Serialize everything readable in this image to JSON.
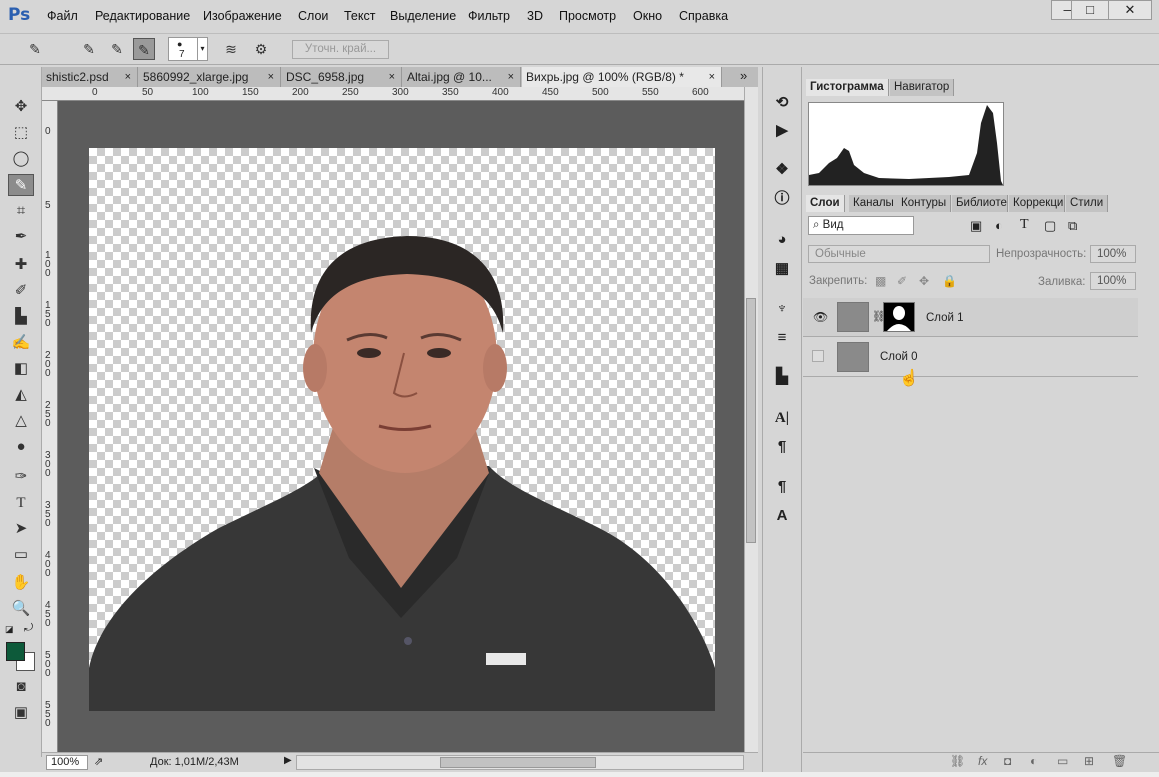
{
  "app": {
    "logo": "Ps"
  },
  "menu": [
    "Файл",
    "Редактирование",
    "Изображение",
    "Слои",
    "Текст",
    "Выделение",
    "Фильтр",
    "3D",
    "Просмотр",
    "Окно",
    "Справка"
  ],
  "window_controls": {
    "minimize": "—",
    "maximize": "□",
    "close": "✕"
  },
  "options": {
    "brush_size": "7",
    "refine_edge": "Уточн. край..."
  },
  "tabs": [
    {
      "label": "shistic2.psd"
    },
    {
      "label": "5860992_xlarge.jpg"
    },
    {
      "label": "DSC_6958.jpg"
    },
    {
      "label": "Altai.jpg @ 10..."
    },
    {
      "label": "Вихрь.jpg @ 100% (RGB/8) *"
    }
  ],
  "tab_close": "×",
  "tab_overflow": "»",
  "ruler_h": [
    "0",
    "50",
    "100",
    "150",
    "200",
    "250",
    "300",
    "350",
    "400",
    "450",
    "500",
    "550",
    "600"
  ],
  "ruler_v": [
    "0",
    "5",
    "100",
    "150",
    "200",
    "250",
    "300",
    "350",
    "400",
    "450",
    "500",
    "550"
  ],
  "status": {
    "zoom": "100%",
    "doc": "Док: 1,01M/2,43M"
  },
  "panel_top": {
    "tab1": "Гистограмма",
    "tab2": "Навигатор"
  },
  "panel_layers": {
    "tabs": [
      "Слои",
      "Каналы",
      "Контуры",
      "Библиоте",
      "Коррекци",
      "Стили"
    ],
    "filter_kind": "Вид",
    "blend_mode": "Обычные",
    "opacity_label": "Непрозрачность:",
    "opacity_value": "100%",
    "lock_label": "Закрепить:",
    "fill_label": "Заливка:",
    "fill_value": "100%",
    "layers": [
      {
        "name": "Слой 1",
        "visible": true
      },
      {
        "name": "Слой 0",
        "visible": false
      }
    ]
  },
  "colors": {
    "foreground": "#0d5a3a",
    "background": "#ffffff",
    "canvas_bg": "#5c5c5c"
  }
}
